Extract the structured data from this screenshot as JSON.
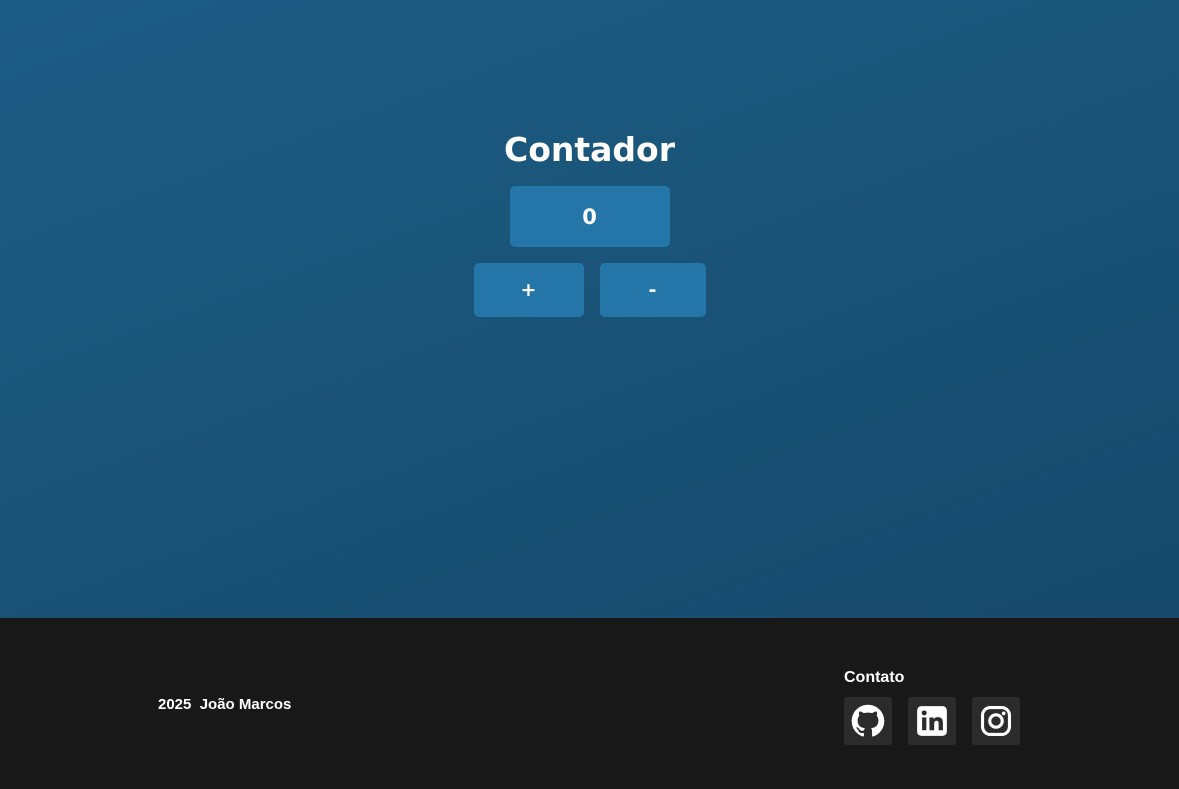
{
  "counter": {
    "title": "Contador",
    "value": "0",
    "increment_label": "+",
    "decrement_label": "-"
  },
  "footer": {
    "copyright": "2025  João Marcos",
    "contact_title": "Contato",
    "socials": [
      {
        "icon": "github-icon",
        "name": "GitHub"
      },
      {
        "icon": "linkedin-icon",
        "name": "LinkedIn"
      },
      {
        "icon": "instagram-icon",
        "name": "Instagram"
      }
    ]
  },
  "colors": {
    "background_gradient_start": "#1d5c86",
    "background_gradient_end": "#164a6c",
    "button": "#2576a8",
    "footer": "#181818",
    "icon_tile": "#2b2b2b",
    "text": "#ffffff"
  }
}
